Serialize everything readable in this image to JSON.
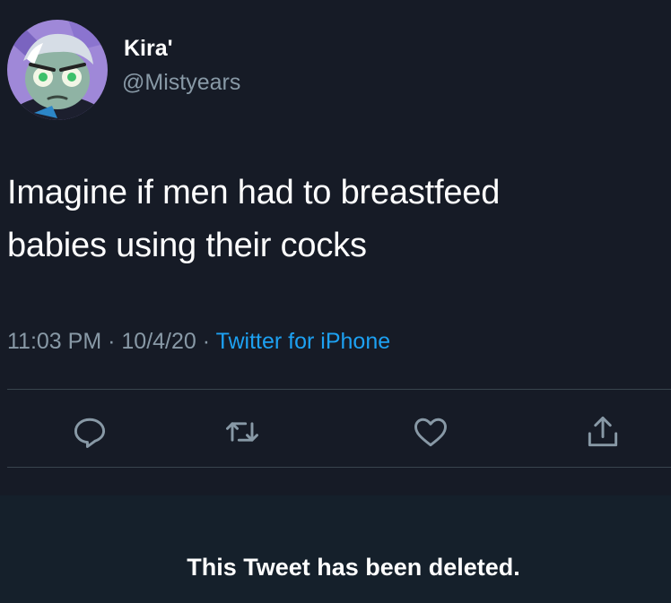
{
  "tweet": {
    "display_name": "Kira'",
    "handle": "@Mistyears",
    "text_line1": "Imagine if men had to breastfeed",
    "text_line2": "babies using their cocks",
    "time": "11:03 PM",
    "date": "10/4/20",
    "separator": "·",
    "source": "Twitter for iPhone"
  },
  "actions": {
    "reply_icon": "reply-icon",
    "retweet_icon": "retweet-icon",
    "like_icon": "heart-icon",
    "share_icon": "share-icon"
  },
  "deleted_notice": "This Tweet has been deleted.",
  "colors": {
    "background": "#161b26",
    "text": "#ffffff",
    "secondary_text": "#8899a6",
    "link": "#1da1f2",
    "divider": "#38444d"
  }
}
